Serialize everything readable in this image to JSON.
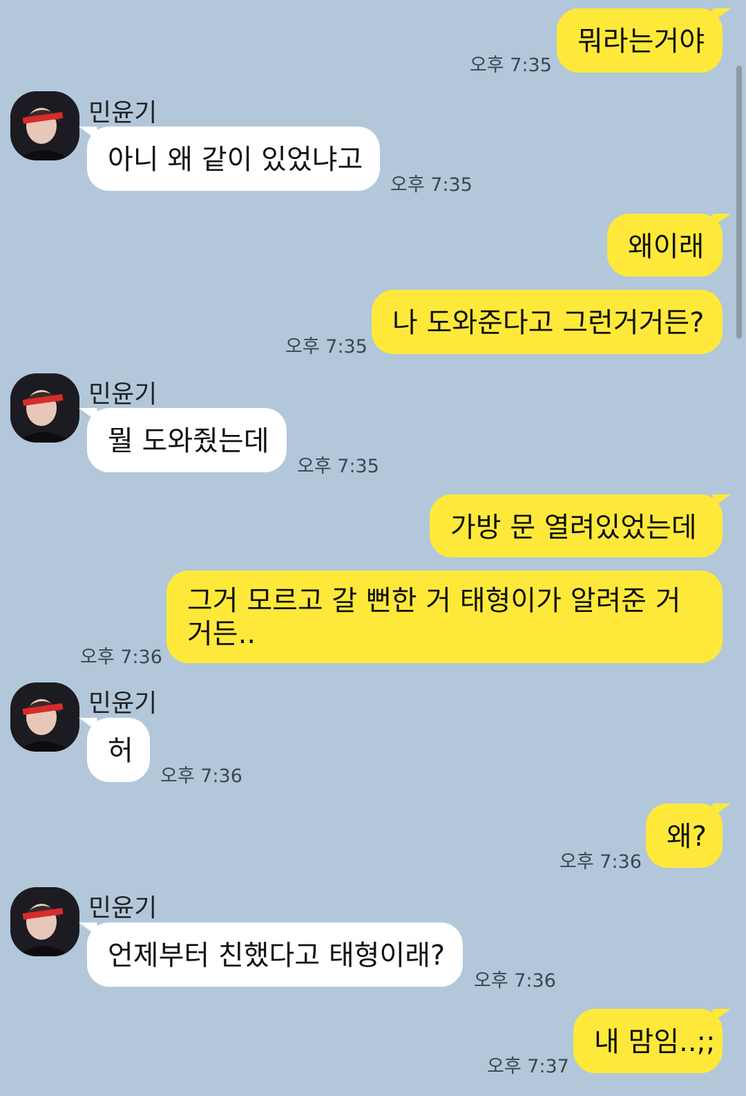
{
  "contact_name": "민윤기",
  "messages": [
    {
      "from": "me",
      "text": "뭐라는거야",
      "time": "오후 7:35"
    },
    {
      "from": "other",
      "text": "아니 왜 같이 있었냐고",
      "time": "오후 7:35"
    },
    {
      "from": "me",
      "text": "왜이래",
      "time": ""
    },
    {
      "from": "me",
      "text": "나 도와준다고 그런거거든?",
      "time": "오후 7:35"
    },
    {
      "from": "other",
      "text": "뭘 도와줬는데",
      "time": "오후 7:35"
    },
    {
      "from": "me",
      "text": "가방 문 열려있었는데",
      "time": ""
    },
    {
      "from": "me",
      "text": "그거 모르고 갈 뻔한 거 태형이가 알려준 거 거든..",
      "time": "오후 7:36"
    },
    {
      "from": "other",
      "text": "허",
      "time": "오후 7:36"
    },
    {
      "from": "me",
      "text": "왜?",
      "time": "오후 7:36"
    },
    {
      "from": "other",
      "text": "언제부터 친했다고 태형이래?",
      "time": "오후 7:36"
    },
    {
      "from": "me",
      "text": "내 맘임..;;",
      "time": "오후 7:37"
    }
  ],
  "colors": {
    "background": "#b2c7da",
    "my_bubble": "#fee93a",
    "other_bubble": "#ffffff"
  },
  "icons": {
    "avatar": "profile-photo-avatar"
  }
}
